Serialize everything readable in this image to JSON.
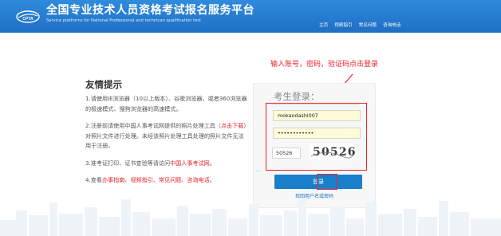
{
  "header": {
    "title": "全国专业技术人员资格考试报名服务平台",
    "subtitle": "Service platforms for National Professional and technican qualification test",
    "nav": [
      "主页",
      "视频指引",
      "常见问题",
      "咨询电话"
    ],
    "logo_icon": "cpta-logo-icon"
  },
  "annotation": "输入账号，密码，验证码点击登录",
  "tips": {
    "title": "友情提示",
    "tip1": "1.请使用IE浏览器（10以上版本）、谷歌浏览器，或者360浏览器的极速模式、搜狗浏览器的高速模式。",
    "tip2_pre": "2.注册前请使用中国人事考试网提供的照片处理工具（",
    "tip2_link": "点击下载",
    "tip2_post": "）对照片文件进行处理。未经该照片处理工具处理的照片文件无法用于注册。",
    "tip3_pre": "3.准考证打印、证书查验等请访问",
    "tip3_link": "中国人事考试网",
    "tip3_post": "。",
    "tip4_pre": "4.查看",
    "tip4_links": [
      "办事指南",
      "视频指引",
      "常见问题",
      "咨询电话"
    ],
    "tip4_sep": "、",
    "tip4_post": "。"
  },
  "login": {
    "title": "考生登录：",
    "username": "mokaodashi007",
    "password": "••••••••••••",
    "captcha_input": "50526",
    "captcha_image_text": "50526",
    "button": "登录",
    "forgot": "找回用户名或密码"
  },
  "colors": {
    "header_blue": "#1f6fc4",
    "accent_red": "#e8232a",
    "button_blue": "#1a7fcb",
    "input_yellow": "#fdfbd9"
  }
}
